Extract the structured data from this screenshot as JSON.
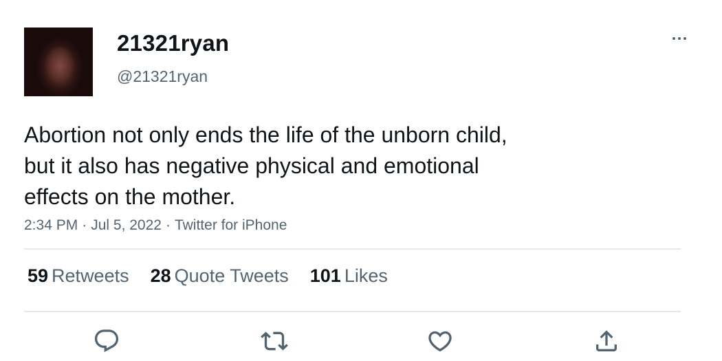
{
  "tweet": {
    "display_name": "21321ryan",
    "handle": "@21321ryan",
    "text": "Abortion not only ends the life of the unborn child,\nbut it also has negative physical and emotional\neffects on the mother.",
    "time": "2:34 PM",
    "date": "Jul 5, 2022",
    "source": "Twitter for iPhone",
    "separator": "·"
  },
  "stats": {
    "retweets": {
      "count": "59",
      "label": "Retweets"
    },
    "quotes": {
      "count": "28",
      "label": "Quote Tweets"
    },
    "likes": {
      "count": "101",
      "label": "Likes"
    }
  },
  "actions": {
    "reply_icon": "reply-icon",
    "retweet_icon": "retweet-icon",
    "like_icon": "heart-icon",
    "share_icon": "share-icon"
  },
  "colors": {
    "text_primary": "#0f1419",
    "text_secondary": "#536471",
    "divider": "#e6e9eb"
  }
}
